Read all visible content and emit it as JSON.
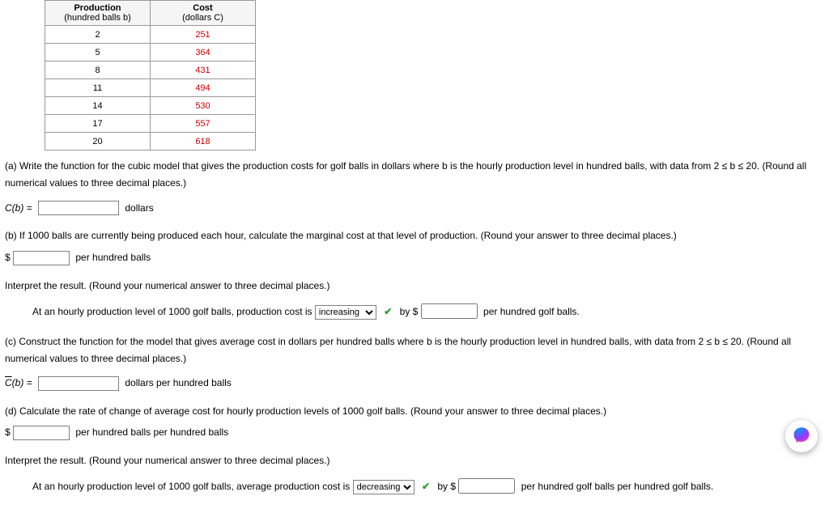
{
  "table": {
    "headers": [
      {
        "line1": "Production",
        "line2": "(hundred balls b)"
      },
      {
        "line1": "Cost",
        "line2": "(dollars C)"
      }
    ],
    "rows": [
      {
        "b": "2",
        "c": "251"
      },
      {
        "b": "5",
        "c": "364"
      },
      {
        "b": "8",
        "c": "431"
      },
      {
        "b": "11",
        "c": "494"
      },
      {
        "b": "14",
        "c": "530"
      },
      {
        "b": "17",
        "c": "557"
      },
      {
        "b": "20",
        "c": "618"
      }
    ]
  },
  "a": {
    "prompt_line1": "(a) Write the function for the cubic model that gives the production costs for golf balls in dollars where b is the hourly production level in hundred balls, with data from  2 ≤ b ≤ 20.  (Round all",
    "prompt_line2": "numerical values to three decimal places.)",
    "lhs": "C(b)  = ",
    "unit": "dollars"
  },
  "b": {
    "prompt": "(b) If 1000 balls are currently being produced each hour, calculate the marginal cost at that level of production. (Round your answer to three decimal places.)",
    "dollar": "$",
    "unit": "per hundred balls",
    "interpret_prompt": "Interpret the result. (Round your numerical answer to three decimal places.)",
    "interpret_pre": "At an hourly production level of 1000 golf balls, production cost is",
    "select_options": [
      "increasing",
      "decreasing"
    ],
    "select_value": "increasing",
    "by": "by $",
    "unit2": "per hundred golf balls."
  },
  "c": {
    "prompt_line1": "(c) Construct the function for the model that gives average cost in dollars per hundred balls where b is the hourly production level in hundred balls, with data from  2 ≤ b ≤ 20.  (Round all",
    "prompt_line2": "numerical values to three decimal places.)",
    "lhs_overline": "C",
    "lhs_rest": "(b)  = ",
    "unit": "dollars per hundred balls"
  },
  "d": {
    "prompt": "(d) Calculate the rate of change of average cost for hourly production levels of 1000 golf balls. (Round your answer to three decimal places.)",
    "dollar": "$",
    "unit": "per hundred balls per hundred balls",
    "interpret_prompt": "Interpret the result. (Round your numerical answer to three decimal places.)",
    "interpret_pre": "At an hourly production level of 1000 golf balls, average production cost is",
    "select_options": [
      "increasing",
      "decreasing"
    ],
    "select_value": "decreasing",
    "by": "by $",
    "unit2": "per hundred golf balls per hundred golf balls."
  },
  "chart_data": {
    "type": "table",
    "title": "Production vs Cost",
    "columns": [
      "Production (hundred balls b)",
      "Cost (dollars C)"
    ],
    "rows": [
      [
        2,
        251
      ],
      [
        5,
        364
      ],
      [
        8,
        431
      ],
      [
        11,
        494
      ],
      [
        14,
        530
      ],
      [
        17,
        557
      ],
      [
        20,
        618
      ]
    ]
  }
}
